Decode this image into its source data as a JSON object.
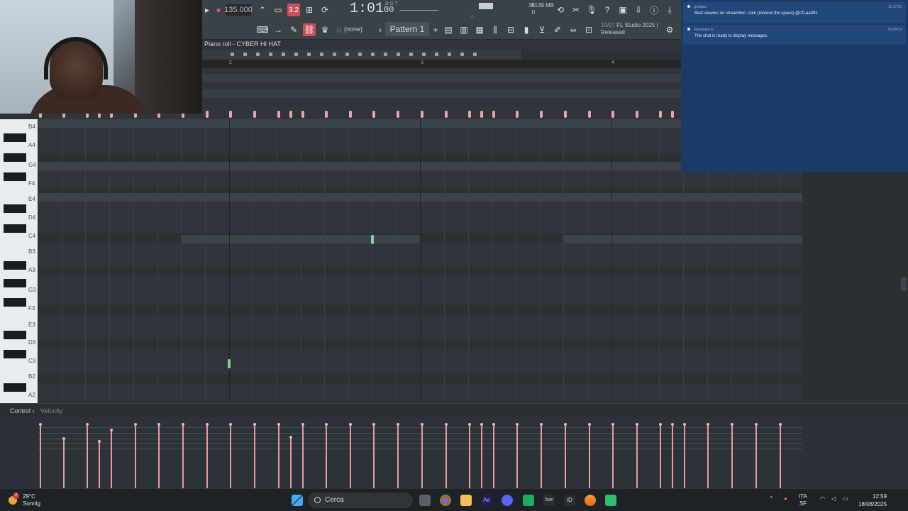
{
  "toolbar": {
    "tempo": "135.000",
    "time": "1:01",
    "time_ticks": "00",
    "bst": "B:S:T",
    "memory": "8139 MB",
    "cpu_count": "35",
    "cpu_zero": "0",
    "pattern": "Pattern 1",
    "preset": "(none)",
    "rec_label": "3.2",
    "fl_version_date": "10/07",
    "fl_name": "FL Studio 2025 |",
    "fl_status": "Released"
  },
  "piano_roll": {
    "title": "Piano roll - CYBER HI HAT",
    "timeline_numbers": [
      "2",
      "3",
      "4"
    ],
    "keys": [
      "B4",
      "A4",
      "G4",
      "F4",
      "E4",
      "D4",
      "C4",
      "B3",
      "A3",
      "G3",
      "F3",
      "E3",
      "D3",
      "C3",
      "B2",
      "A2"
    ]
  },
  "control": {
    "label": "Control",
    "arrow": "›",
    "param": "Velocity"
  },
  "chat": {
    "messages": [
      {
        "user": "gentasc",
        "text": "Best viewers on streamboo .com (remove the space) @rZLaa09z",
        "time": "11:17:50"
      },
      {
        "user": "Restream.io",
        "text": "The chat is ready to display messages.",
        "time": "10:04:03"
      }
    ]
  },
  "taskbar": {
    "temperature": "29°C",
    "condition": "Sonnig",
    "search_placeholder": "Cerca",
    "lang": "ITA",
    "lang2": "SF",
    "time": "12:59",
    "date": "18/08/2025",
    "badge": "2"
  },
  "colors": {
    "note": "#7fd29a",
    "velocity": "#e99aa2",
    "chat_bg": "#1b3a68"
  }
}
